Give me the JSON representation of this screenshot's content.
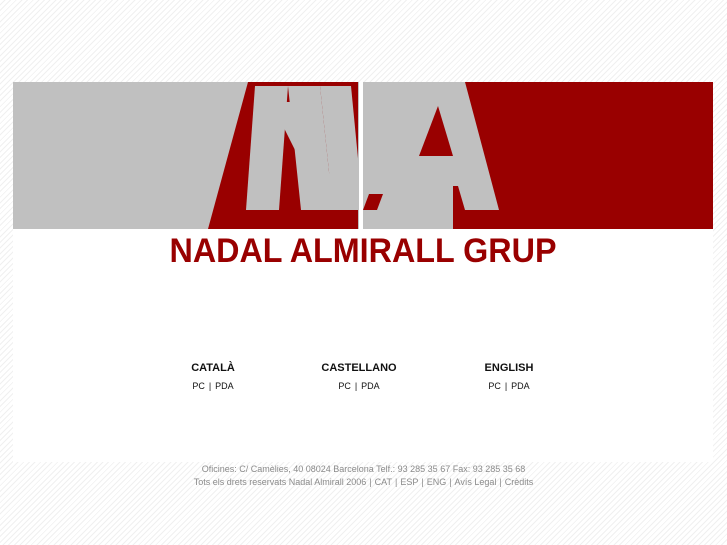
{
  "brand": {
    "logo_letters": "NA",
    "name": "NADAL ALMIRALL GRUP",
    "colors": {
      "red": "#990000",
      "grey": "#c0c0c0",
      "white": "#ffffff"
    }
  },
  "languages": [
    {
      "title": "CATALÀ",
      "pc": "PC",
      "pda": "PDA"
    },
    {
      "title": "CASTELLANO",
      "pc": "PC",
      "pda": "PDA"
    },
    {
      "title": "ENGLISH",
      "pc": "PC",
      "pda": "PDA"
    }
  ],
  "separator": "|",
  "footer": {
    "address": "Oficines: C/ Camèlies, 40 08024 Barcelona Telf.: 93 285 35 67 Fax: 93 285 35 68",
    "rights": "Tots els drets reservats Nadal Almirall 2006",
    "links": [
      "CAT",
      "ESP",
      "ENG",
      "Avís Legal",
      "Crèdits"
    ]
  }
}
